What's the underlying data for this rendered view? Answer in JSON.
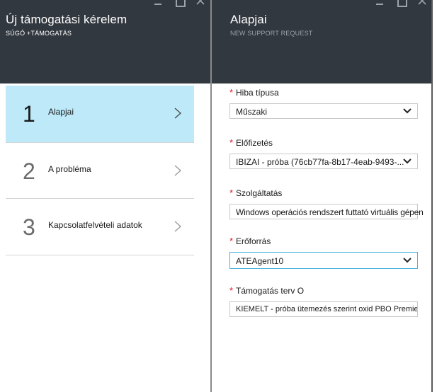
{
  "left_blade": {
    "title": "Új támogatási kérelem",
    "subtitle": "SÚGÓ +TÁMOGATÁS",
    "steps": [
      {
        "number": "1",
        "label": "Alapjai",
        "active": true
      },
      {
        "number": "2",
        "label": "A probléma",
        "active": false
      },
      {
        "number": "3",
        "label": "Kapcsolatfelvételi adatok",
        "active": false
      }
    ]
  },
  "right_blade": {
    "title": "Alapjai",
    "subtitle": "NEW SUPPORT REQUEST",
    "fields": [
      {
        "label": "Hiba típusa",
        "value": "Műszaki",
        "required": true
      },
      {
        "label": "Előfizetés",
        "value": "IBIZAI - próba (76cb77fa-8b17-4eab-9493-...",
        "required": true
      },
      {
        "label": "Szolgáltatás",
        "value": "Windows operációs rendszert futtató virtuális gépen",
        "required": true
      },
      {
        "label": "Erőforrás",
        "value": "ATEAgent10",
        "required": true
      },
      {
        "label": "Támogatás terv O",
        "value": "KIEMELT - próba ütemezés szerint oxid PBO Premier...",
        "required": true
      }
    ]
  },
  "colors": {
    "header_bg": "#32383f",
    "active_step_bg": "#bde9f9",
    "required_star": "#e81123",
    "focus_border": "#4bb2de"
  },
  "icons": {
    "minimize": "minimize-icon",
    "maximize": "maximize-icon",
    "close": "close-icon",
    "step_chevron": "chevron-right-icon",
    "select_arrow": "chevron-down-icon"
  }
}
